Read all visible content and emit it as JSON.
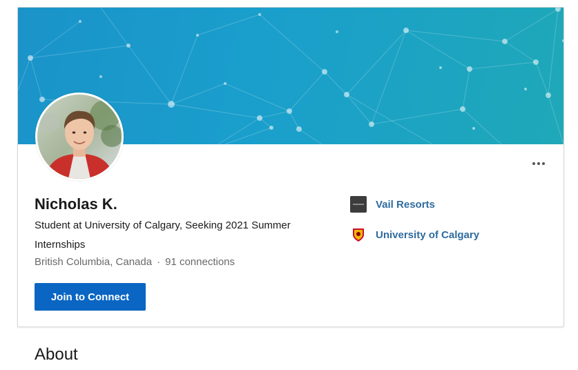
{
  "profile": {
    "name": "Nicholas K.",
    "headline": "Student at University of Calgary, Seeking 2021 Summer Internships",
    "location": "British Columbia, Canada",
    "separator": "·",
    "connections": "91 connections",
    "join_button": "Join to Connect",
    "more_menu": "more-options-icon"
  },
  "experience": {
    "items": [
      {
        "label": "Vail Resorts",
        "icon": "company-logo-icon"
      },
      {
        "label": "University of Calgary",
        "icon": "school-crest-icon"
      }
    ]
  },
  "sections": {
    "about_title": "About"
  },
  "colors": {
    "banner_start": "#1a93c9",
    "banner_end": "#1fa8b8",
    "primary_button": "#0a66c2",
    "link": "#2e6b9e"
  }
}
